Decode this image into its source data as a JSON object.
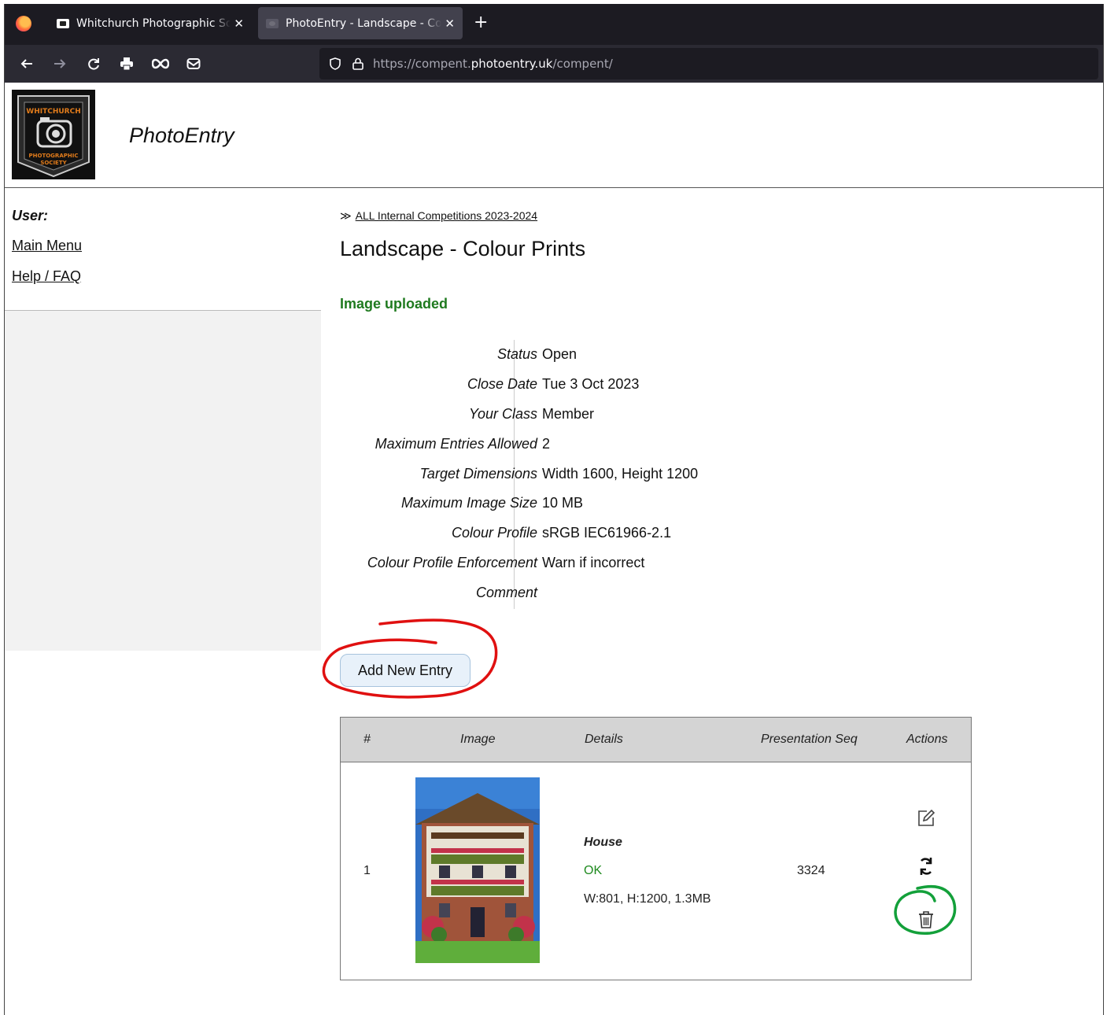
{
  "browser": {
    "tabs": [
      {
        "title": "Whitchurch Photographic Society",
        "active": false
      },
      {
        "title": "PhotoEntry - Landscape - Colour Prints",
        "active": true
      }
    ],
    "close_glyph": "✕",
    "new_tab_glyph": "+",
    "url_prefix": "https://compent.",
    "url_domain": "photoentry.uk",
    "url_path": "/compent/",
    "nav_icons": [
      "back-icon",
      "forward-icon",
      "reload-icon",
      "print-icon",
      "infinity-icon",
      "mail-icon"
    ]
  },
  "header": {
    "logo_text_top": "WHITCHURCH",
    "logo_text_bottom": "PHOTOGRAPHIC",
    "logo_text_bottom2": "SOCIETY",
    "brand": "PhotoEntry"
  },
  "sidebar": {
    "user_label": "User:",
    "links": [
      "Main Menu",
      "Help / FAQ"
    ]
  },
  "main": {
    "breadcrumb_glyph": "≫",
    "breadcrumb": "ALL Internal Competitions 2023-2024",
    "title": "Landscape - Colour Prints",
    "message": "Image uploaded",
    "properties": [
      {
        "label": "Status",
        "value": "Open"
      },
      {
        "label": "Close Date",
        "value": "Tue 3 Oct 2023"
      },
      {
        "label": "Your Class",
        "value": "Member"
      },
      {
        "label": "Maximum Entries Allowed",
        "value": "2"
      },
      {
        "label": "Target Dimensions",
        "value": "Width 1600, Height 1200"
      },
      {
        "label": "Maximum Image Size",
        "value": "10 MB"
      },
      {
        "label": "Colour Profile",
        "value": "sRGB IEC61966-2.1"
      },
      {
        "label": "Colour Profile Enforcement",
        "value": "Warn if incorrect"
      },
      {
        "label": "Comment",
        "value": ""
      }
    ],
    "add_button": "Add New Entry",
    "table": {
      "headers": [
        "#",
        "Image",
        "Details",
        "Presentation Seq",
        "Actions"
      ],
      "rows": [
        {
          "num": "1",
          "title": "House",
          "status": "OK",
          "info": "W:801, H:1200, 1.3MB",
          "seq": "3324",
          "actions": [
            "edit-icon",
            "replace-icon",
            "delete-icon"
          ]
        }
      ]
    }
  },
  "colors": {
    "success": "#1f7a1f",
    "annotation_red": "#e01010",
    "annotation_green": "#13a03a",
    "button_bg": "#e8f1fa"
  }
}
